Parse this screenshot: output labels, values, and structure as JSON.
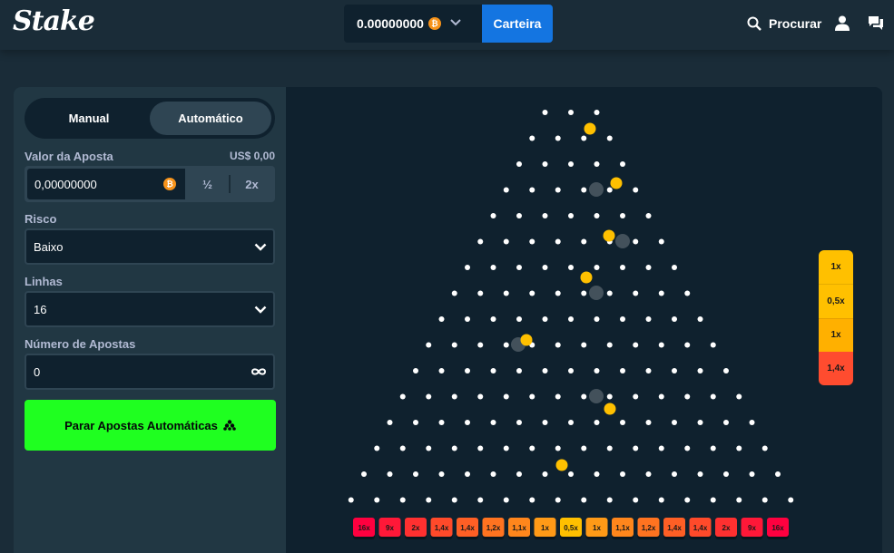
{
  "header": {
    "logo": "Stake",
    "balance": "0.00000000",
    "wallet_label": "Carteira",
    "search_label": "Procurar"
  },
  "sidebar": {
    "tabs": [
      {
        "label": "Manual",
        "active": false
      },
      {
        "label": "Automático",
        "active": true
      }
    ],
    "bet_amount_label": "Valor da Aposta",
    "bet_amount_usd": "US$ 0,00",
    "bet_amount_value": "0,00000000",
    "half_label": "½",
    "double_label": "2x",
    "risk_label": "Risco",
    "risk_value": "Baixo",
    "rows_label": "Linhas",
    "rows_value": "16",
    "bets_count_label": "Número de Apostas",
    "bets_count_value": "0",
    "stop_label": "Parar Apostas Automáticas"
  },
  "board": {
    "rows": 16,
    "multipliers": [
      "16x",
      "9x",
      "2x",
      "1,4x",
      "1,4x",
      "1,2x",
      "1,1x",
      "1x",
      "0,5x",
      "1x",
      "1,1x",
      "1,2x",
      "1,4x",
      "1,4x",
      "2x",
      "9x",
      "16x"
    ],
    "recent_results": [
      {
        "label": "1x",
        "color": "#ffc000"
      },
      {
        "label": "0,5x",
        "color": "#ffc000"
      },
      {
        "label": "1x",
        "color": "#ffb000"
      },
      {
        "label": "1,4x",
        "color": "#ff4c2f"
      }
    ]
  },
  "colors": {
    "accent": "#1475e1",
    "stop_button": "#1fff20",
    "ball": "#ffc000",
    "peg": "#ffffff"
  }
}
